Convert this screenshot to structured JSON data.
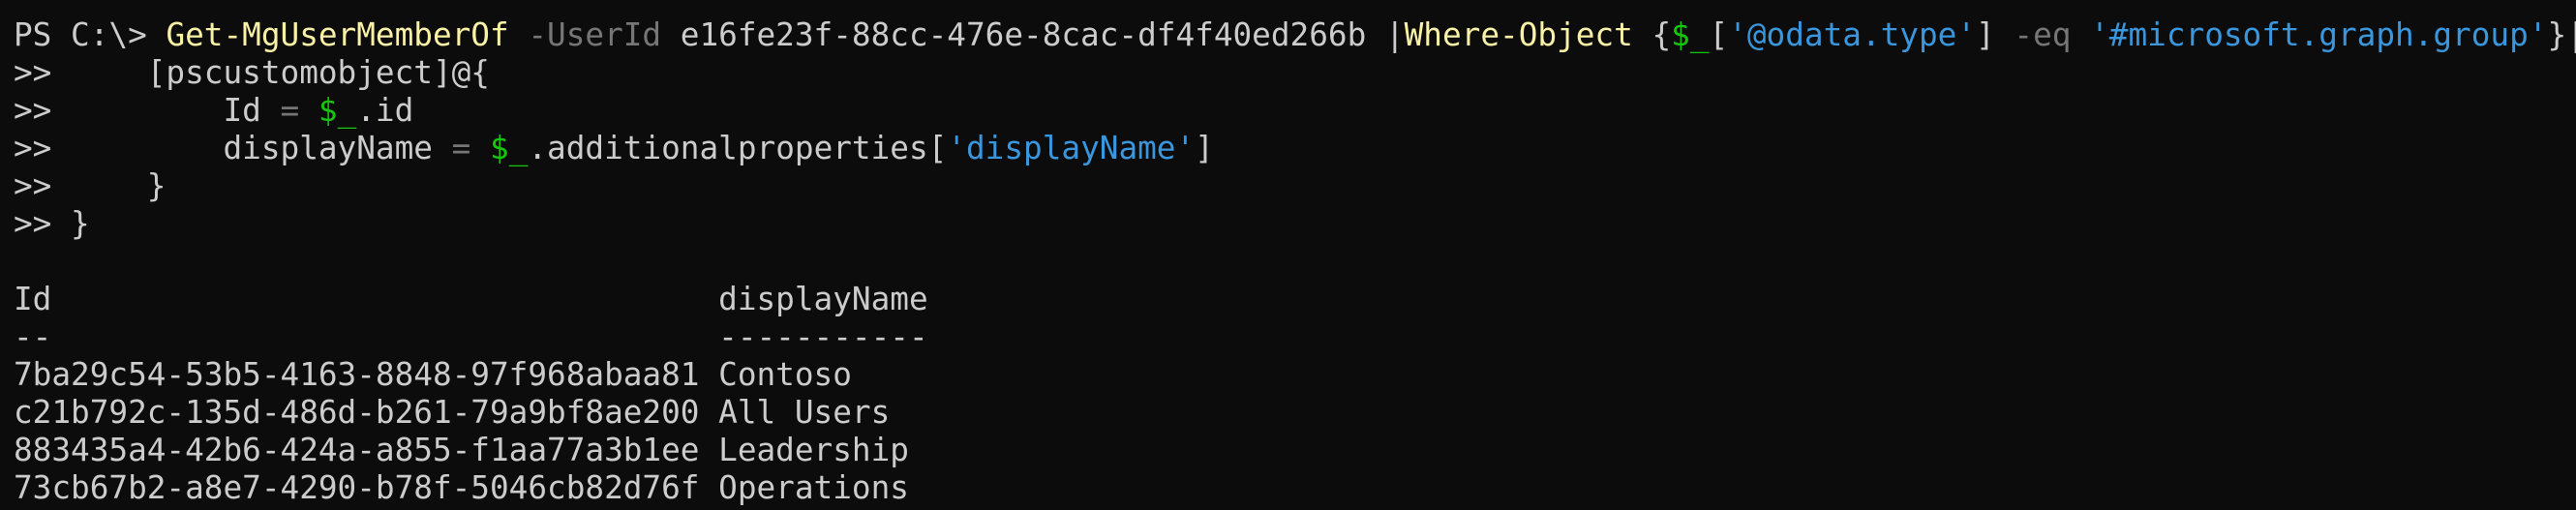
{
  "terminal": {
    "lines": [
      {
        "segments": [
          {
            "text": "PS C:\\> ",
            "style": "plain"
          },
          {
            "text": "Get-MgUserMemberOf",
            "style": "cmd"
          },
          {
            "text": " -UserId",
            "style": "param"
          },
          {
            "text": " e16fe23f-88cc-476e-8cac-df4f40ed266b ",
            "style": "plain"
          },
          {
            "text": "|",
            "style": "plain"
          },
          {
            "text": "Where-Object",
            "style": "cmd"
          },
          {
            "text": " {",
            "style": "plain"
          },
          {
            "text": "$_",
            "style": "var"
          },
          {
            "text": "[",
            "style": "plain"
          },
          {
            "text": "'@odata.type'",
            "style": "str"
          },
          {
            "text": "] ",
            "style": "plain"
          },
          {
            "text": "-eq",
            "style": "param"
          },
          {
            "text": " ",
            "style": "plain"
          },
          {
            "text": "'#microsoft.graph.group'",
            "style": "str"
          },
          {
            "text": "}| ",
            "style": "plain"
          },
          {
            "text": "%",
            "style": "cmd"
          },
          {
            "text": "{",
            "style": "plain"
          }
        ]
      },
      {
        "segments": [
          {
            "text": ">>     [pscustomobject]@{",
            "style": "plain"
          }
        ]
      },
      {
        "segments": [
          {
            "text": ">>         Id ",
            "style": "plain"
          },
          {
            "text": "=",
            "style": "op"
          },
          {
            "text": " ",
            "style": "plain"
          },
          {
            "text": "$_",
            "style": "var"
          },
          {
            "text": ".id",
            "style": "plain"
          }
        ]
      },
      {
        "segments": [
          {
            "text": ">>         displayName ",
            "style": "plain"
          },
          {
            "text": "=",
            "style": "op"
          },
          {
            "text": " ",
            "style": "plain"
          },
          {
            "text": "$_",
            "style": "var"
          },
          {
            "text": ".additionalproperties[",
            "style": "plain"
          },
          {
            "text": "'displayName'",
            "style": "str"
          },
          {
            "text": "]",
            "style": "plain"
          }
        ]
      },
      {
        "segments": [
          {
            "text": ">>     }",
            "style": "plain"
          }
        ]
      },
      {
        "segments": [
          {
            "text": ">> }",
            "style": "plain"
          }
        ]
      },
      {
        "segments": []
      },
      {
        "segments": [
          {
            "text": "Id                                   displayName",
            "style": "plain"
          }
        ]
      },
      {
        "segments": [
          {
            "text": "--                                   -----------",
            "style": "plain"
          }
        ]
      },
      {
        "segments": [
          {
            "text": "7ba29c54-53b5-4163-8848-97f968abaa81 Contoso",
            "style": "plain"
          }
        ]
      },
      {
        "segments": [
          {
            "text": "c21b792c-135d-486d-b261-79a9bf8ae200 All Users",
            "style": "plain"
          }
        ]
      },
      {
        "segments": [
          {
            "text": "883435a4-42b6-424a-a855-f1aa77a3b1ee Leadership",
            "style": "plain"
          }
        ]
      },
      {
        "segments": [
          {
            "text": "73cb67b2-a8e7-4290-b78f-5046cb82d76f Operations",
            "style": "plain"
          }
        ]
      }
    ]
  },
  "colors": {
    "background": "#0c0c0c",
    "text": "#cccccc",
    "command": "#f9f1a5",
    "parameter": "#767676",
    "string": "#3a96dd",
    "variable": "#16c60c"
  }
}
